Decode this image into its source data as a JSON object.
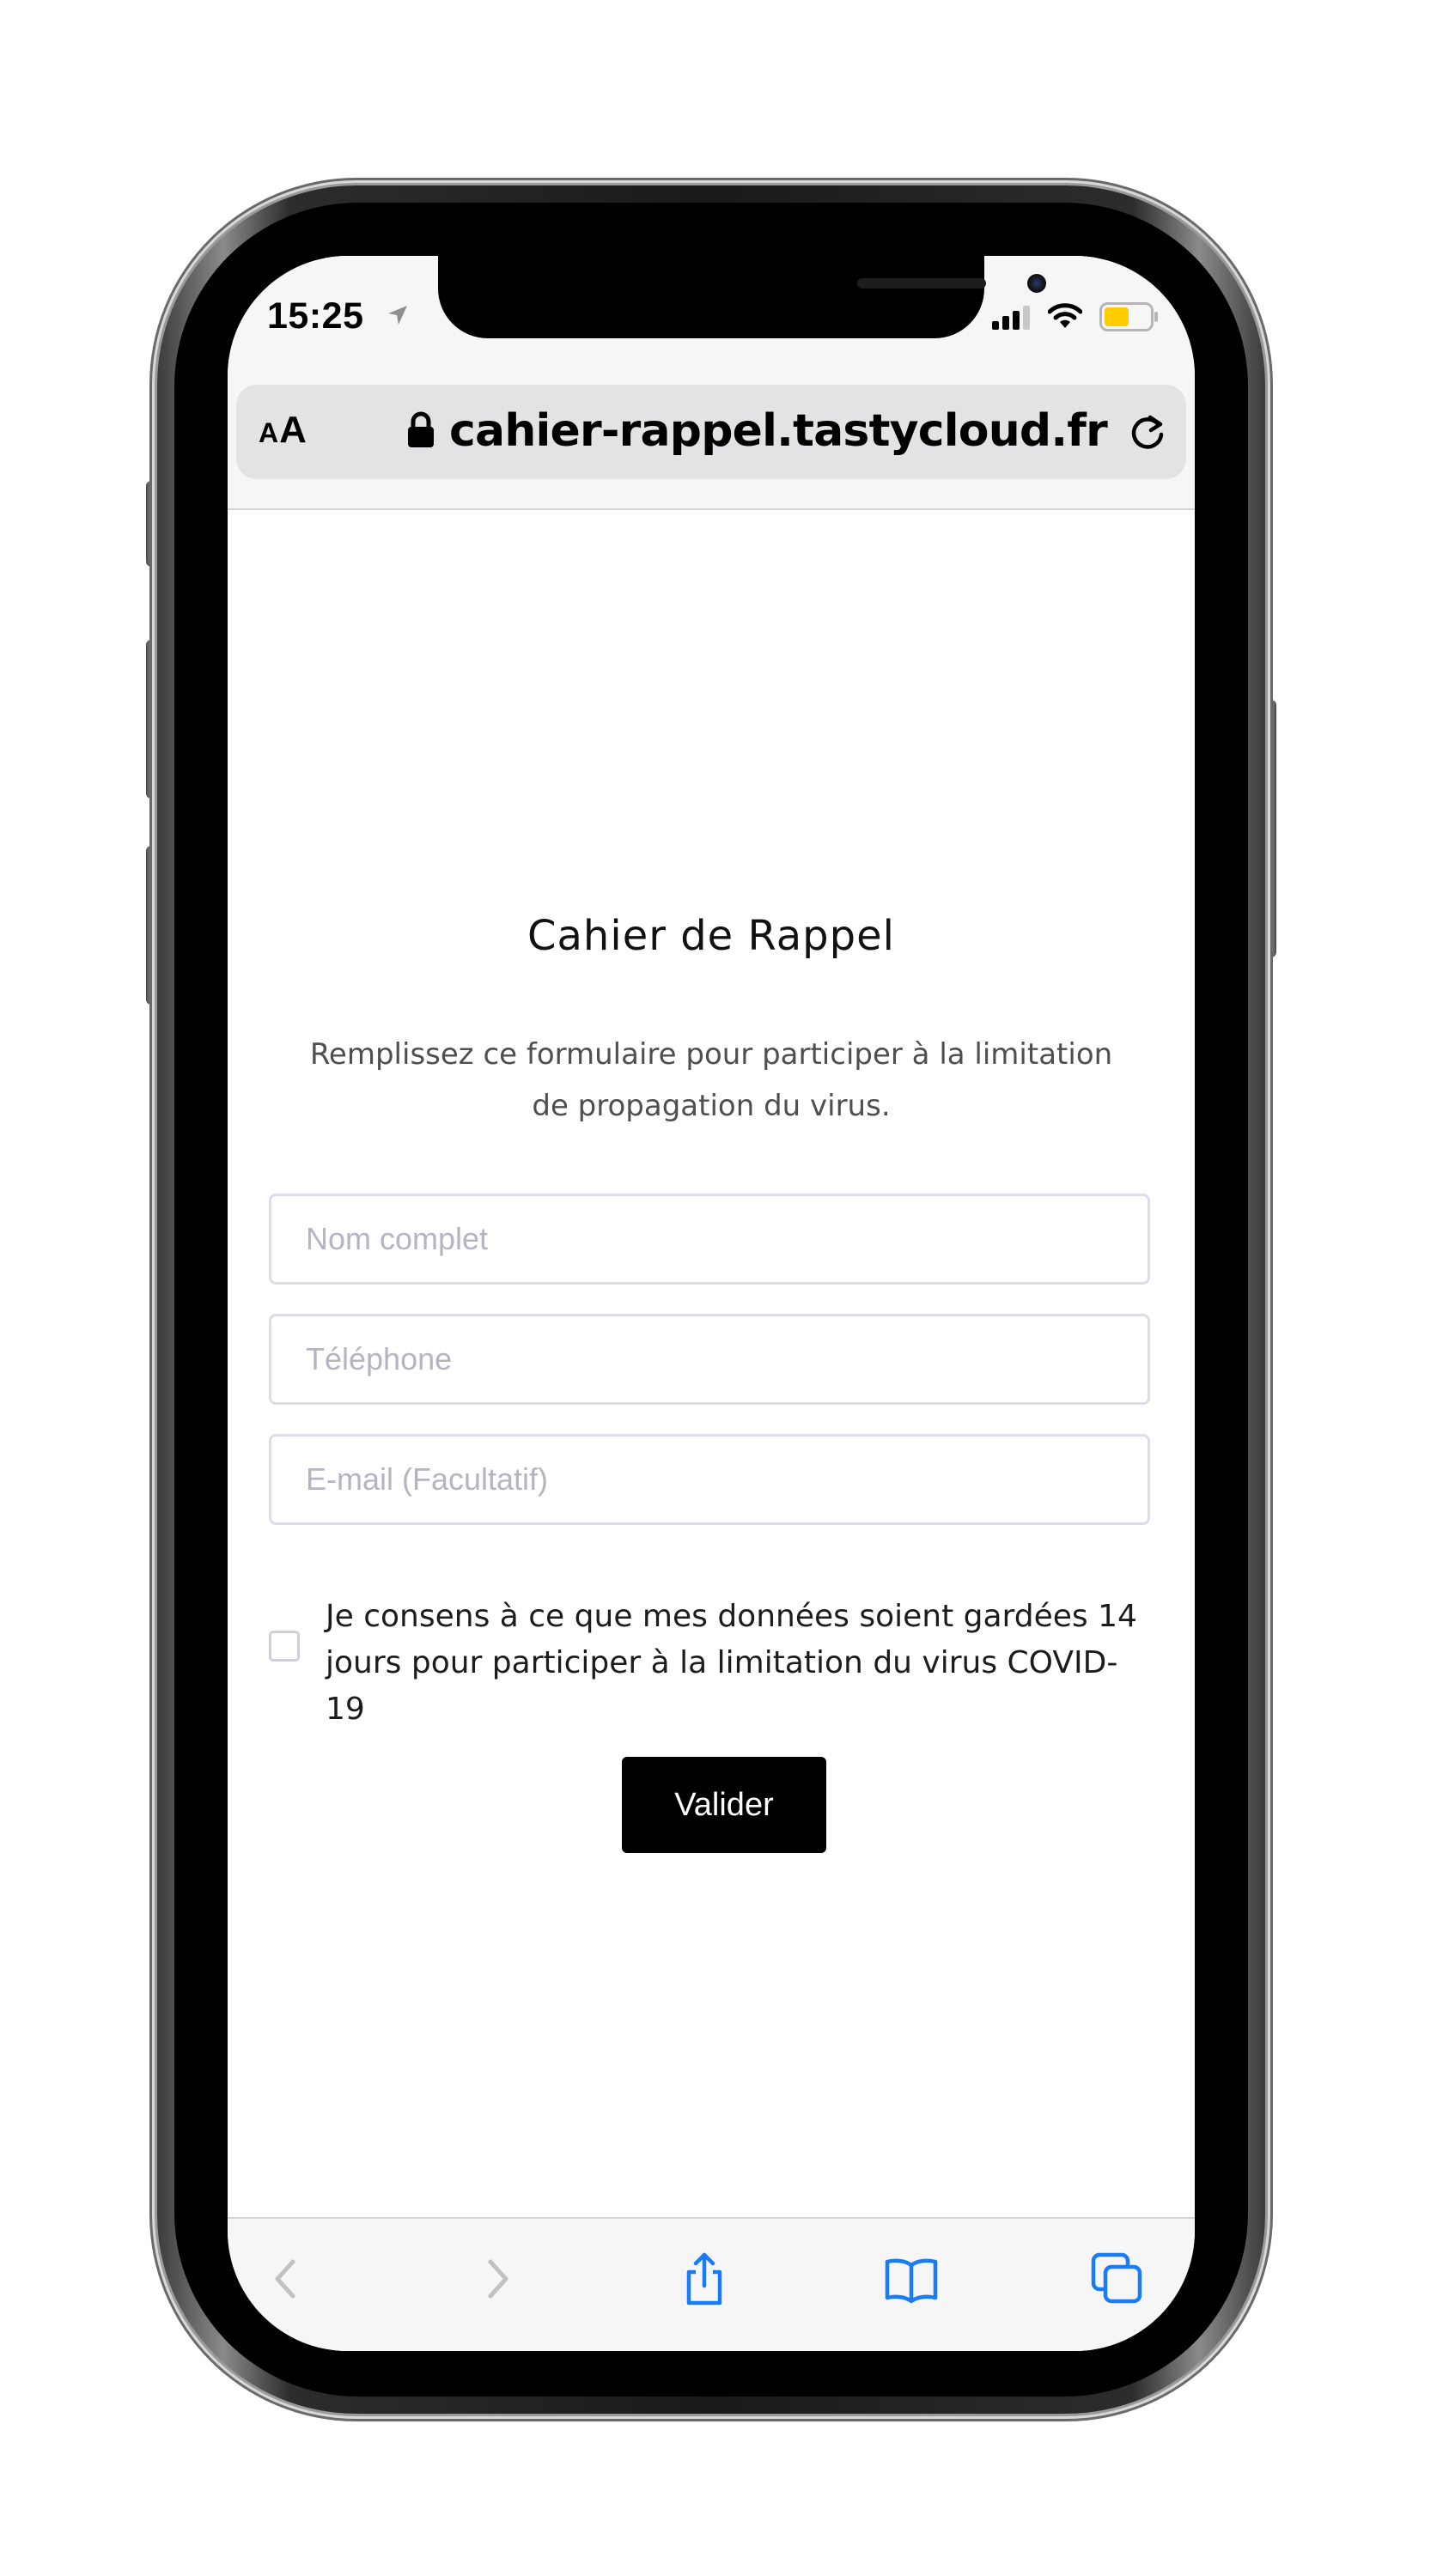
{
  "status_bar": {
    "time": "15:25",
    "icons": [
      "location-arrow-icon",
      "signal-icon",
      "wifi-icon",
      "battery-icon"
    ],
    "battery_color": "#ffcc00"
  },
  "browser": {
    "text_size_label_small": "A",
    "text_size_label_large": "A",
    "url": "cahier-rappel.tastycloud.fr",
    "icons": [
      "lock-icon",
      "reload-icon"
    ]
  },
  "page": {
    "title": "Cahier de Rappel",
    "subtitle": "Remplissez ce formulaire pour participer à la limitation de propagation du virus.",
    "fields": {
      "name_placeholder": "Nom complet",
      "phone_placeholder": "Téléphone",
      "email_placeholder": "E-mail (Facultatif)"
    },
    "consent": {
      "checked": false,
      "text": "Je consens à ce que mes données soient gardées 14 jours pour participer à la limitation du virus COVID-19"
    },
    "submit_label": "Valider"
  },
  "toolbar": {
    "items": [
      "back-icon",
      "forward-icon",
      "share-icon",
      "bookmarks-icon",
      "tabs-icon"
    ],
    "active_color": "#1a7cf5",
    "disabled_color": "#c0c0c5"
  }
}
